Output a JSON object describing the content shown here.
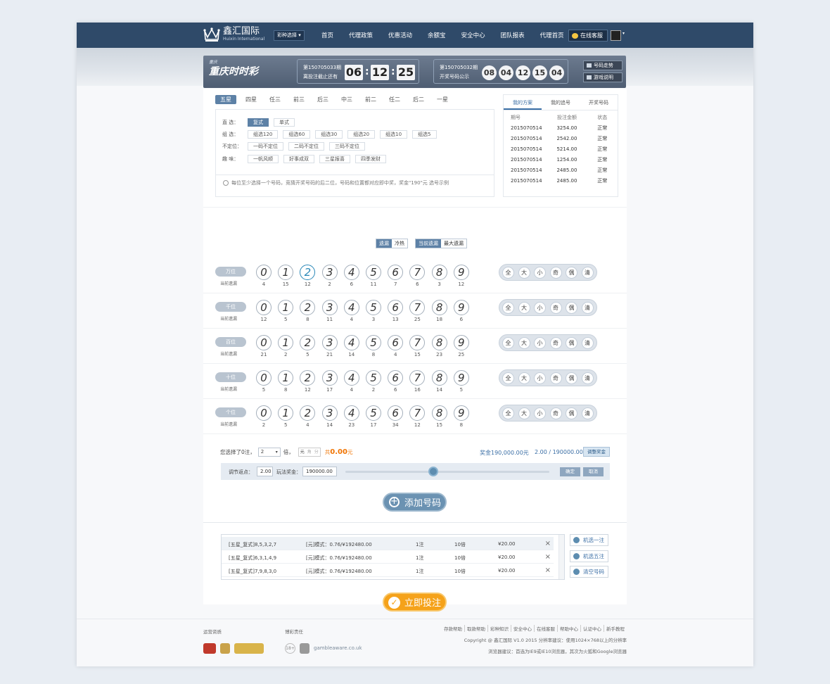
{
  "header": {
    "brand_cn": "鑫汇国际",
    "brand_en": "Huixin International",
    "lottery_select": "彩种选择",
    "nav": [
      "首页",
      "代理政策",
      "优惠活动",
      "余额宝",
      "安全中心",
      "团队报表",
      "代理首页"
    ],
    "service": "在线客服"
  },
  "banner": {
    "logo_small": "重庆",
    "logo_text": "重庆时时彩",
    "current_issue": "第150705033期",
    "deadline_label": "离投注截止还有",
    "countdown": [
      "06",
      "12",
      "25"
    ],
    "last_issue": "第150705032期",
    "last_label": "开奖号码公示",
    "draw_numbers": [
      "08",
      "04",
      "12",
      "15",
      "04"
    ],
    "btn_trend": "号码走势",
    "btn_rules": "游戏说明"
  },
  "play": {
    "tabs": [
      "五星",
      "四星",
      "任三",
      "前三",
      "后三",
      "中三",
      "前二",
      "任二",
      "后二",
      "一星"
    ],
    "active_tab": 0,
    "rows": [
      {
        "label": "直  选：",
        "options": [
          "复式",
          "单式"
        ],
        "active": 0
      },
      {
        "label": "组  选：",
        "options": [
          "组选120",
          "组选60",
          "组选30",
          "组选20",
          "组选10",
          "组选5"
        ],
        "active": -1
      },
      {
        "label": "不定位：",
        "options": [
          "一码不定位",
          "二码不定位",
          "三码不定位"
        ],
        "active": -1
      },
      {
        "label": "趣  味：",
        "options": [
          "一帆风顺",
          "好事成双",
          "三星报喜",
          "四季发财"
        ],
        "active": -1
      }
    ],
    "hint": "每位至少选择一个号码，竞猜开奖号码的后二位，号码和位置都对应即中奖，奖金\"190\"元 选号示例"
  },
  "records": {
    "tabs": [
      "我的方案",
      "我的追号",
      "开奖号码"
    ],
    "headers": [
      "期号",
      "投注金额",
      "状态"
    ],
    "rows": [
      [
        "2015070514",
        "3254.00",
        "正常"
      ],
      [
        "2015070514",
        "2542.00",
        "正常"
      ],
      [
        "2015070514",
        "5214.00",
        "正常"
      ],
      [
        "2015070514",
        "1254.00",
        "正常"
      ],
      [
        "2015070514",
        "2485.00",
        "正常"
      ],
      [
        "2015070514",
        "2485.00",
        "正常"
      ]
    ]
  },
  "picker": {
    "toggle1": [
      "遗漏",
      "冷热"
    ],
    "toggle2": [
      "当前遗漏",
      "最大遗漏"
    ],
    "sub_label": "当前遗漏",
    "quick": [
      "全",
      "大",
      "小",
      "奇",
      "偶",
      "清"
    ],
    "positions": [
      {
        "name": "万位",
        "miss": [
          "4",
          "15",
          "12",
          "2",
          "6",
          "11",
          "7",
          "6",
          "3",
          "12"
        ],
        "selected": [
          2
        ]
      },
      {
        "name": "千位",
        "miss": [
          "12",
          "5",
          "8",
          "11",
          "4",
          "3",
          "13",
          "25",
          "18",
          "6"
        ],
        "selected": []
      },
      {
        "name": "百位",
        "miss": [
          "21",
          "2",
          "5",
          "21",
          "14",
          "8",
          "4",
          "15",
          "23",
          "25"
        ],
        "selected": []
      },
      {
        "name": "十位",
        "miss": [
          "5",
          "8",
          "12",
          "17",
          "4",
          "2",
          "6",
          "16",
          "14",
          "5"
        ],
        "selected": []
      },
      {
        "name": "个位",
        "miss": [
          "2",
          "5",
          "4",
          "14",
          "23",
          "17",
          "34",
          "12",
          "15",
          "8"
        ],
        "selected": []
      }
    ],
    "digits": [
      "0",
      "1",
      "2",
      "3",
      "4",
      "5",
      "6",
      "7",
      "8",
      "9"
    ]
  },
  "summary": {
    "selected_prefix": "您选择了0注，",
    "multiple": "2",
    "multiple_suffix": "倍，",
    "units": [
      "元",
      "角",
      "分"
    ],
    "total_prefix": "共",
    "total_amount": "0.00",
    "total_suffix": "元",
    "prize": "奖金190,000.00元",
    "ratio": "2.00 / 190000.00",
    "adjust_btn": "调整奖金",
    "rebate_label": "调节返点：",
    "rebate_value": "2.00",
    "method_prize_label": "玩法奖金：",
    "method_prize_value": "190000.00",
    "slider_value": 0.43,
    "confirm": "确定",
    "cancel": "取消",
    "add_btn": "添加号码"
  },
  "betlist": {
    "rows": [
      [
        "[五星_复式]8,5,3,2,7",
        "[元]模式：0.76/¥192480.00",
        "1注",
        "10倍",
        "¥20.00"
      ],
      [
        "[五星_复式]6,3,1,4,9",
        "[元]模式：0.76/¥192480.00",
        "1注",
        "10倍",
        "¥20.00"
      ],
      [
        "[五星_复式]7,9,8,3,0",
        "[元]模式：0.76/¥192480.00",
        "1注",
        "10倍",
        "¥20.00"
      ]
    ],
    "side_buttons": [
      "机选一注",
      "机选五注",
      "清空号码"
    ],
    "submit": "立即投注"
  },
  "footer": {
    "title1": "运营资质",
    "title2": "博彩责任",
    "links": [
      "存款帮助",
      "取款帮助",
      "彩种知识",
      "安全中心",
      "在线客服",
      "帮助中心",
      "认证中心",
      "新手教程"
    ],
    "copyright": "Copyright @ 鑫汇国际 V1.0 2015  分辨率建议：使用1024×768以上的分辨率",
    "browser": "浏览器建议：首选为IE9或IE10浏览器，其次为火狐和Google浏览器",
    "age": "18+",
    "gamble": "gambleaware.co.uk"
  },
  "colors": {
    "nav": "#2f4a69",
    "accent": "#5d81a6",
    "orange": "#f5a21a"
  }
}
